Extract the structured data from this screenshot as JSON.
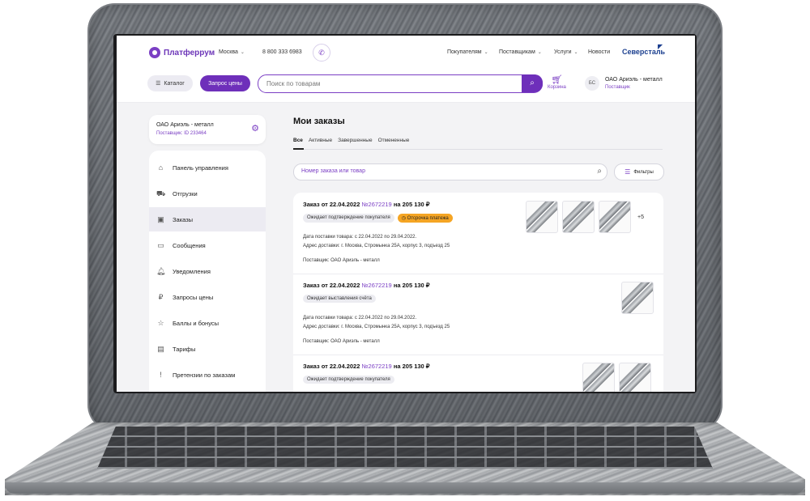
{
  "header": {
    "logo": "Платферрум",
    "city": "Москва",
    "phone": "8 800 333 6983",
    "nav": [
      "Покупателям",
      "Поставщикам",
      "Услуги",
      "Новости"
    ],
    "brand": "Северсталь",
    "catalog_label": "Каталог",
    "price_request_label": "Запрос цены",
    "search_placeholder": "Поиск по товарам",
    "cart_label": "Корзина",
    "user_initials": "БС",
    "user_company": "ОАО Ариэль - металл",
    "user_role": "Поставщик"
  },
  "sidebar": {
    "profile_name": "ОАО Ариэль - металл",
    "profile_id": "Поставщик: ID 233464",
    "items": [
      {
        "label": "Панель управления",
        "icon": "home-icon",
        "active": false
      },
      {
        "label": "Отгрузки",
        "icon": "truck-icon",
        "active": false
      },
      {
        "label": "Заказы",
        "icon": "bag-icon",
        "active": true
      },
      {
        "label": "Сообщения",
        "icon": "chat-icon",
        "active": false
      },
      {
        "label": "Уведомления",
        "icon": "bell-icon",
        "active": false
      },
      {
        "label": "Запросы цены",
        "icon": "price-chat-icon",
        "active": false
      },
      {
        "label": "Баллы и бонусы",
        "icon": "star-icon",
        "active": false
      },
      {
        "label": "Тарифы",
        "icon": "tariff-icon",
        "active": false
      },
      {
        "label": "Претензии по заказам",
        "icon": "claim-icon",
        "active": false
      }
    ]
  },
  "main": {
    "title": "Мои заказы",
    "tabs": [
      "Все",
      "Активные",
      "Завершенные",
      "Отмененные"
    ],
    "search_placeholder": "Номер заказа или товар",
    "filters_label": "Фильтры",
    "orders": [
      {
        "title_prefix": "Заказ от 22.04.2022",
        "number": "№2672219",
        "amount": "на 205 130 ₽",
        "status": "Ожидает подтверждение покупателя",
        "extra_badge": "Отсрочка платежа",
        "delivery_date": "Дата поставки товара: с 22.04.2022 по 29.04.2022.",
        "address": "Адрес доставки: г. Москва, Стромынка 25А, корпус 3, подъезд 25",
        "supplier": "Поставщик: ОАО Ариэль - металл",
        "thumb_count": 3,
        "more": "+5"
      },
      {
        "title_prefix": "Заказ от 22.04.2022",
        "number": "№2672219",
        "amount": "на 205 130 ₽",
        "status": "Ожидает выставления счёта",
        "delivery_date": "Дата поставки товара: с 22.04.2022 по 29.04.2022.",
        "address": "Адрес доставки: г. Москва, Стромынка 25А, корпус 3, подъезд 25",
        "supplier": "Поставщик: ОАО Ариэль - металл",
        "thumb_count": 1
      },
      {
        "title_prefix": "Заказ от 22.04.2022",
        "number": "№2672219",
        "amount": "на 205 130 ₽",
        "status": "Ожидает подтверждение покупателя",
        "thumb_count": 2
      }
    ]
  },
  "colors": {
    "accent": "#6e2fba",
    "warning": "#f5a524",
    "brand": "#1b3f8f"
  }
}
